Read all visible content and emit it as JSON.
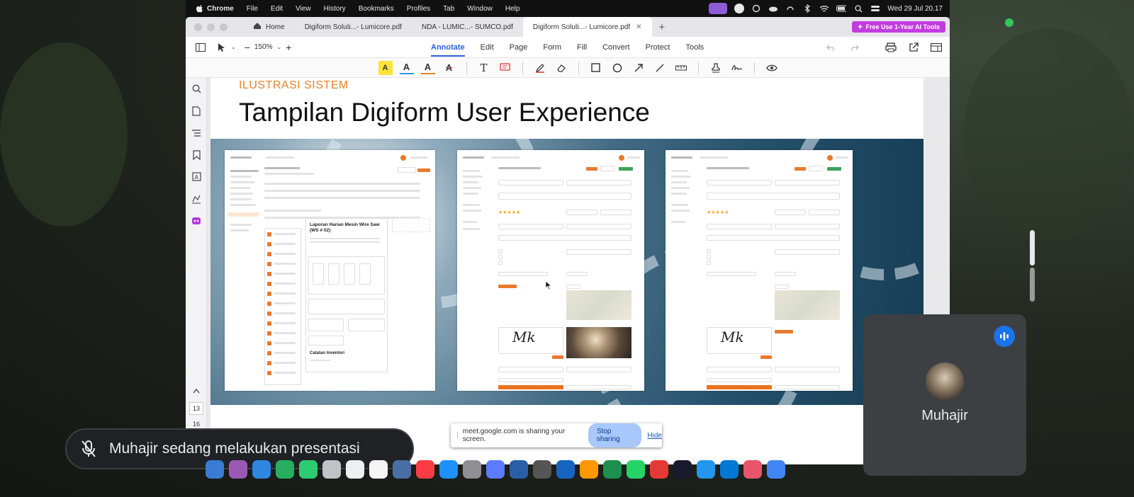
{
  "menubar": {
    "items": [
      "Chrome",
      "File",
      "Edit",
      "View",
      "History",
      "Bookmarks",
      "Profiles",
      "Tab",
      "Window",
      "Help"
    ],
    "clock": "Wed 29 Jul  20.17"
  },
  "tabs": [
    {
      "label": "Home"
    },
    {
      "label": "Digiform Soluti...- Lumicore.pdf"
    },
    {
      "label": "NDA - LUMIC...- SUMCO.pdf"
    },
    {
      "label": "Digiform Soluti...- Lumicore.pdf",
      "active": true
    }
  ],
  "promo_label": "Free Use 1-Year AI Tools",
  "toolbar": {
    "zoom": "150%",
    "menu": [
      "Annotate",
      "Edit",
      "Page",
      "Form",
      "Fill",
      "Convert",
      "Protect",
      "Tools"
    ],
    "active_menu": "Annotate"
  },
  "annotate_tools": {
    "highlight": "A",
    "underline": "A",
    "squiggly": "A",
    "strike": "A",
    "text": "T"
  },
  "sidebar": {
    "page_current": "13",
    "page_next": "16"
  },
  "slide": {
    "subtitle": "ILUSTRASI SISTEM",
    "title": "Tampilan Digiform User Experience",
    "report_heading": "Laporan Harian Mesin Wire Saw (WS # 02)",
    "notes_heading": "Catatan Inventori",
    "signature": "Mk"
  },
  "meet": {
    "presenting_notice": "Muhajir sedang melakukan presentasi",
    "sharing_text": "meet.google.com is sharing your screen.",
    "stop_sharing": "Stop sharing",
    "hide": "Hide",
    "participant_name": "Muhajir"
  },
  "colors": {
    "accent": "#2d5fd6",
    "orange": "#e8822a",
    "promo": "#c33ce0",
    "meet_tile": "#3c4043"
  }
}
